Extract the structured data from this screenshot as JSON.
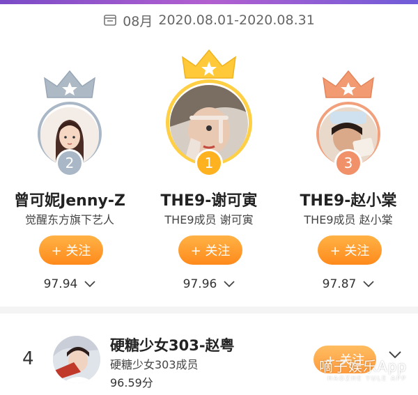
{
  "period": {
    "month": "08月",
    "range": "2020.08.01-2020.08.31"
  },
  "podium": [
    {
      "rank": "2",
      "name": "曾可妮Jenny-Z",
      "subtitle": "觉醒东方旗下艺人",
      "follow": "+ 关注",
      "score": "97.94",
      "medal": "silver"
    },
    {
      "rank": "1",
      "name": "THE9-谢可寅",
      "subtitle": "THE9成员 谢可寅",
      "follow": "+ 关注",
      "score": "97.96",
      "medal": "gold"
    },
    {
      "rank": "3",
      "name": "THE9-赵小棠",
      "subtitle": "THE9成员 赵小棠",
      "follow": "+ 关注",
      "score": "97.87",
      "medal": "bronze"
    }
  ],
  "list": [
    {
      "rank": "4",
      "name": "硬糖少女303-赵粤",
      "subtitle": "硬糖少女303成员",
      "score": "96.59分",
      "follow": "+ 关注"
    }
  ],
  "watermark": {
    "text": "嘀子娱乐App",
    "sub": "HAOZHE YULE APP"
  },
  "colors": {
    "accent": "#ff9a2e",
    "gold": "#ffc93a",
    "silver": "#a9b7c6",
    "bronze": "#f29b73"
  },
  "icons": [
    "calendar-icon",
    "crown-icon",
    "chevron-down-icon"
  ]
}
